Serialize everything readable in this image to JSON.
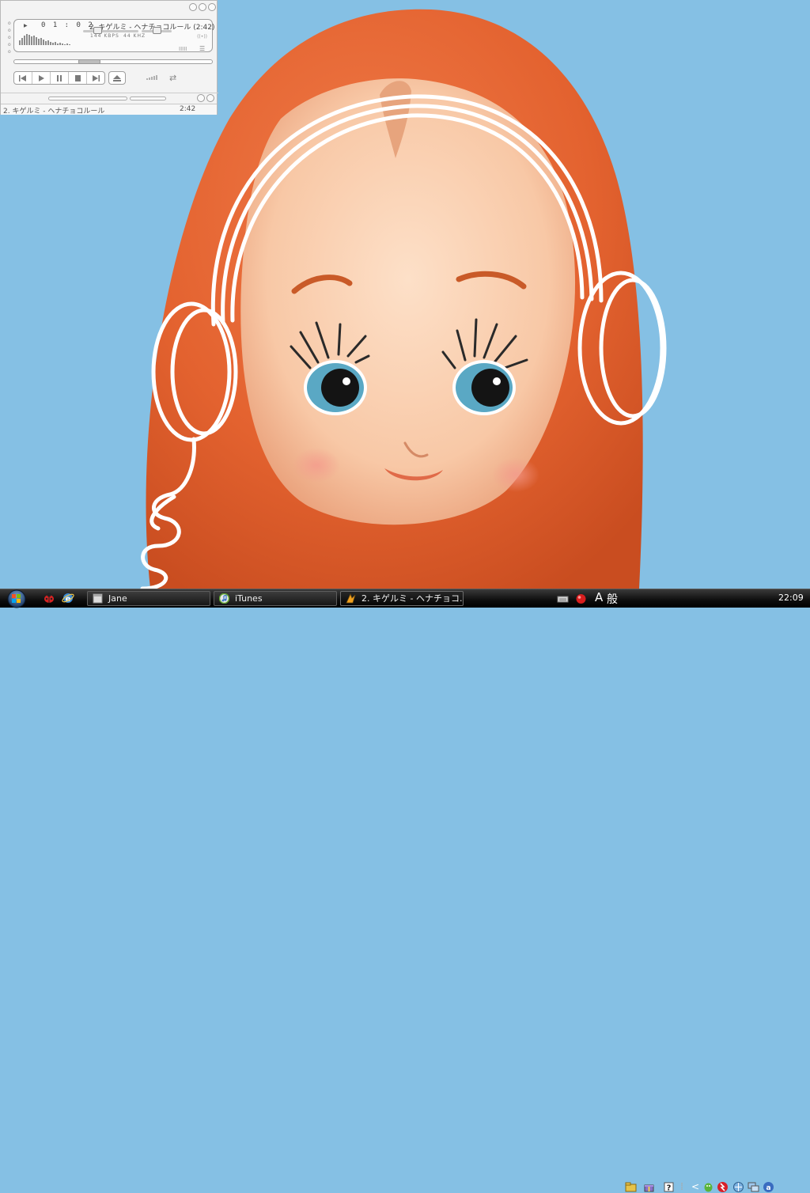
{
  "desktop": {
    "background_color": "#85c0e4",
    "wallpaper": "kewpie-doll-in-orange-hood-with-drawn-headphones"
  },
  "player": {
    "time": "0 1 : 0 2",
    "track_title": "2. キゲルミ - ヘナチョコルール (2:42)",
    "bitrate": "144 KBPS",
    "sample_rate": "44 KHZ",
    "stereo": "((•))",
    "eq_label": "IIIII",
    "playlist_label": "☰",
    "volume_level": 0.2,
    "balance_level": 0.5,
    "seek_position": 0.37,
    "controls": [
      "previous",
      "play",
      "pause",
      "stop",
      "next"
    ],
    "playlist": {
      "item_title": "2. キゲルミ - ヘナチョコルール",
      "item_time": "2:42"
    },
    "colors": {
      "face": "#f3f3f3",
      "text": "#444444",
      "border": "#9e9e9e"
    }
  },
  "taskbar": {
    "tasks": [
      {
        "label": "Jane",
        "icon": "blank-window-icon"
      },
      {
        "label": "iTunes",
        "icon": "itunes-icon"
      },
      {
        "label": "2. キゲルミ - ヘナチョコ...",
        "icon": "winamp-icon"
      }
    ],
    "quick_launch": [
      "ladybug-icon",
      "internet-explorer-icon"
    ],
    "ime": {
      "mode": "A",
      "kanji": "般"
    },
    "tray_icons": [
      "keyboard-icon",
      "red-ball-icon",
      "folder-icon",
      "gift-icon",
      "help-icon",
      "show-hidden-icon",
      "green-bug-icon",
      "antivirus-icon",
      "network-icon",
      "monitor-icon",
      "app-icon"
    ],
    "clock": "22:09",
    "colors": {
      "bar": "#0d0d0d",
      "text": "#f0f0f0"
    }
  }
}
